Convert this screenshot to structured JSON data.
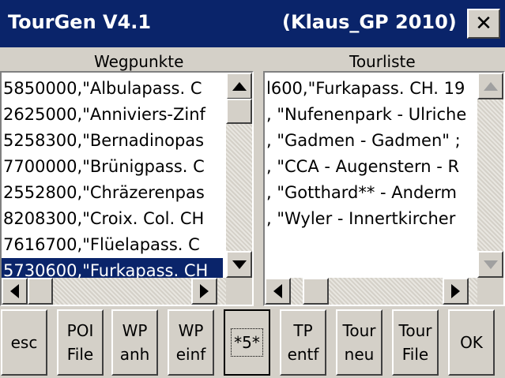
{
  "window": {
    "app_title": "TourGen V4.1",
    "user_info": "(Klaus_GP 2010)",
    "close_label": "✕"
  },
  "waypoints": {
    "header": "Wegpunkte",
    "rows": [
      "5850000,\"Albulapass. C",
      "2625000,\"Anniviers-Zinf",
      "5258300,\"Bernadinopas",
      "7700000,\"Brünigpass. C",
      "2552800,\"Chräzerenpas",
      "8208300,\"Croix. Col. CH",
      "7616700,\"Flüelapass. C",
      "5730600,\"Furkapass. CH"
    ],
    "selected_index": 7
  },
  "tourlist": {
    "header": "Tourliste",
    "rows": [
      "l600,\"Furkapass. CH. 19",
      ", \"Nufenenpark - Ulriche",
      ", \"Gadmen - Gadmen\" ;",
      ", \"CCA - Augenstern - R",
      ", \"Gotthard** - Anderm",
      ", \"Wyler - Innertkircher"
    ]
  },
  "buttons": [
    {
      "id": "esc",
      "lines": [
        "esc"
      ]
    },
    {
      "id": "poi-file",
      "lines": [
        "POI",
        "File"
      ]
    },
    {
      "id": "wp-anh",
      "lines": [
        "WP",
        "anh"
      ]
    },
    {
      "id": "wp-einf",
      "lines": [
        "WP",
        "einf"
      ]
    },
    {
      "id": "star5",
      "lines": [
        "*5*"
      ]
    },
    {
      "id": "tp-entf",
      "lines": [
        "TP",
        "entf"
      ]
    },
    {
      "id": "tour-neu",
      "lines": [
        "Tour",
        "neu"
      ]
    },
    {
      "id": "tour-file",
      "lines": [
        "Tour",
        "File"
      ]
    },
    {
      "id": "ok",
      "lines": [
        "OK"
      ]
    }
  ],
  "colors": {
    "titlebar": "#0a246a",
    "selection": "#0a246a",
    "face": "#d4d0c8"
  },
  "icons": {
    "close": "close-icon",
    "up": "arrow-up-icon",
    "down": "arrow-down-icon",
    "left": "arrow-left-icon",
    "right": "arrow-right-icon"
  }
}
